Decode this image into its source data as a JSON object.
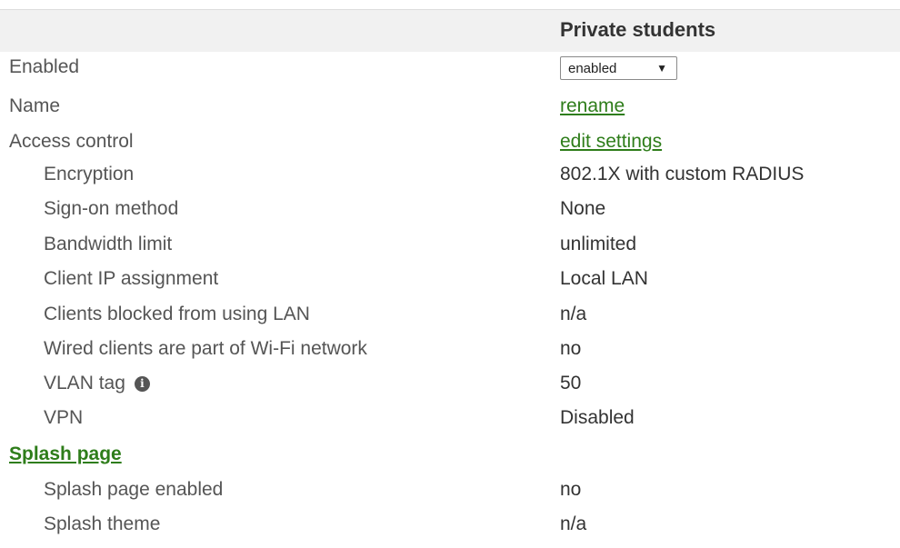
{
  "header": {
    "column_title": "Private students"
  },
  "rows": {
    "enabled": {
      "label": "Enabled",
      "select_value": "enabled",
      "arrow": "▼"
    },
    "name": {
      "label": "Name",
      "link": "rename"
    },
    "access_control": {
      "label": "Access control",
      "link": "edit settings"
    },
    "encryption": {
      "label": "Encryption",
      "value": "802.1X with custom RADIUS"
    },
    "sign_on": {
      "label": "Sign-on method",
      "value": "None"
    },
    "bandwidth": {
      "label": "Bandwidth limit",
      "value": "unlimited"
    },
    "client_ip": {
      "label": "Client IP assignment",
      "value": "Local LAN"
    },
    "blocked_lan": {
      "label": "Clients blocked from using LAN",
      "value": "n/a"
    },
    "wired_clients": {
      "label": "Wired clients are part of Wi-Fi network",
      "value": "no"
    },
    "vlan": {
      "label": "VLAN tag",
      "value": "50",
      "icon": "info-icon",
      "icon_glyph": "i"
    },
    "vpn": {
      "label": "VPN",
      "value": "Disabled"
    }
  },
  "splash": {
    "section_link": "Splash page",
    "enabled": {
      "label": "Splash page enabled",
      "value": "no"
    },
    "theme": {
      "label": "Splash theme",
      "value": "n/a"
    }
  },
  "colors": {
    "link": "#2e7d1a",
    "header_bg": "#f1f1f1",
    "label_text": "#555555",
    "value_text": "#333333"
  }
}
